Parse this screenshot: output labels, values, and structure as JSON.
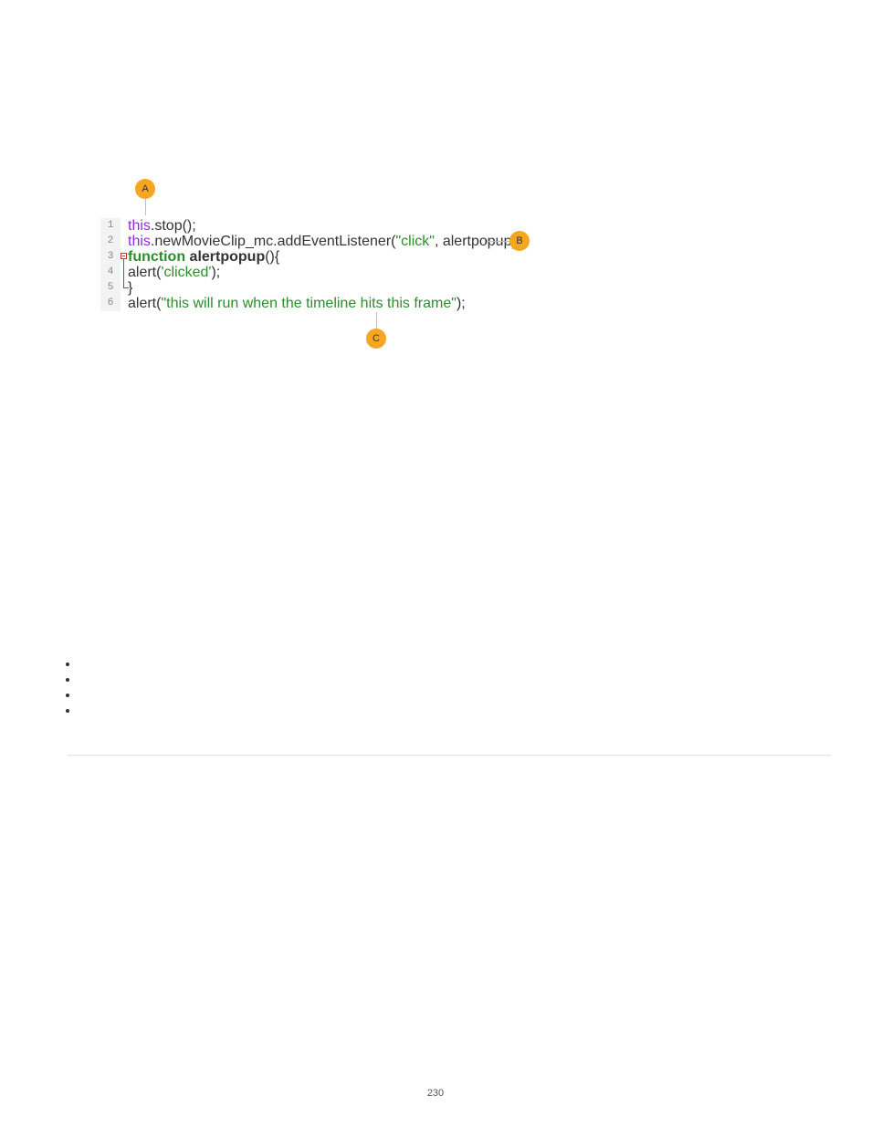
{
  "callouts": {
    "a": "A",
    "b": "B",
    "c": "C"
  },
  "code": {
    "line_numbers": [
      "1",
      "2",
      "3",
      "4",
      "5",
      "6"
    ],
    "line1": {
      "this": "this",
      "rest": ".stop();"
    },
    "line2": {
      "this": "this",
      "mid": ".newMovieClip_mc.addEventListener(",
      "str": "\"click\"",
      "rest": ", alertpopup);"
    },
    "line3": {
      "kw": "function",
      "sp": " ",
      "fn": "alertpopup",
      "rest": "(){"
    },
    "line4": {
      "pre": "  alert(",
      "str": "'clicked'",
      "post": ");"
    },
    "line5": {
      "text": "}"
    },
    "line6": {
      "pre": "alert(",
      "str": "\"this will run when the timeline hits this frame\"",
      "post": ");"
    }
  },
  "page_number": "230"
}
